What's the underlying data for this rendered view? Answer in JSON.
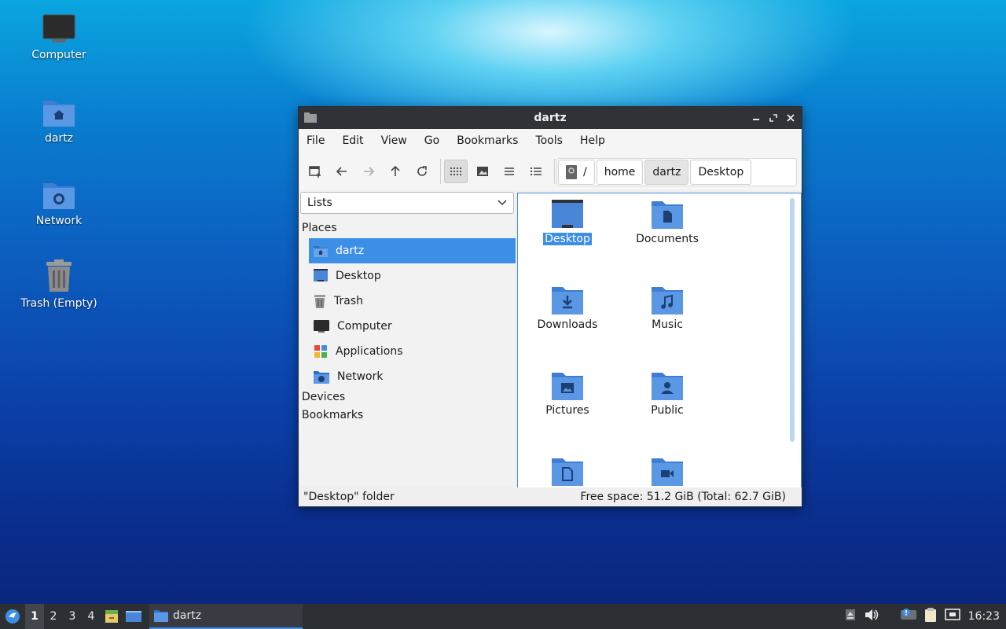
{
  "desktop": {
    "icons": [
      {
        "label": "Computer"
      },
      {
        "label": "dartz"
      },
      {
        "label": "Network"
      },
      {
        "label": "Trash (Empty)"
      }
    ]
  },
  "window": {
    "title": "dartz",
    "menu": [
      "File",
      "Edit",
      "View",
      "Go",
      "Bookmarks",
      "Tools",
      "Help"
    ],
    "path": [
      "/",
      "home",
      "dartz",
      "Desktop"
    ],
    "sidebar": {
      "select_value": "Lists",
      "places_header": "Places",
      "places": [
        "dartz",
        "Desktop",
        "Trash",
        "Computer",
        "Applications",
        "Network"
      ],
      "devices_header": "Devices",
      "bookmarks_header": "Bookmarks"
    },
    "files": [
      "Desktop",
      "Documents",
      "Downloads",
      "Music",
      "Pictures",
      "Public"
    ],
    "status_left": "\"Desktop\" folder",
    "status_right": "Free space: 51.2 GiB (Total: 62.7 GiB)"
  },
  "taskbar": {
    "workspaces": [
      "1",
      "2",
      "3",
      "4"
    ],
    "task_label": "dartz",
    "clock": "16:23"
  },
  "colors": {
    "accent": "#3d8ee6",
    "folder": "#4a86d8",
    "titlebar": "#2f3338",
    "taskbar": "#2c2f33"
  }
}
